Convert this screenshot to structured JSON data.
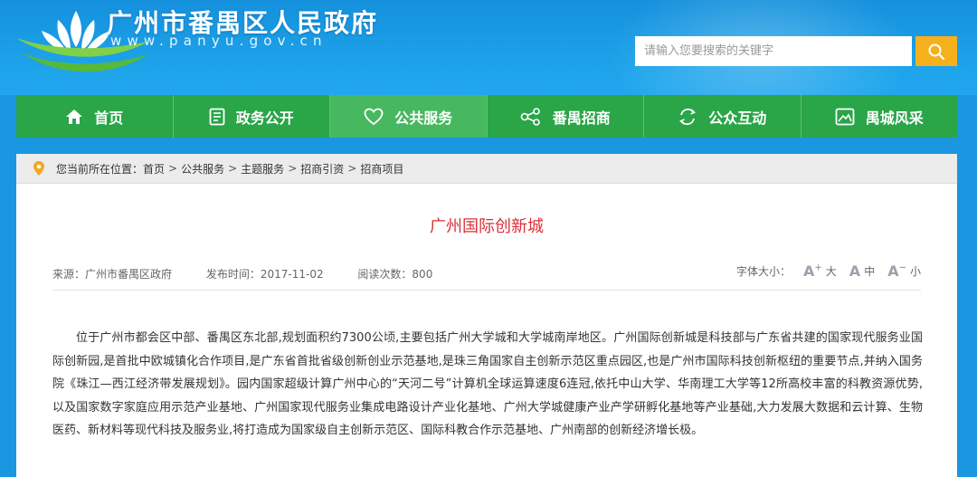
{
  "header": {
    "site_title": "广州市番禺区人民政府",
    "site_domain": "www.panyu.gov.cn",
    "search_placeholder": "请输入您要搜索的关键字",
    "logo_icon": "lotus-logo-icon",
    "search_icon": "search-icon"
  },
  "nav": {
    "items": [
      {
        "label": "首页",
        "icon": "home-icon"
      },
      {
        "label": "政务公开",
        "icon": "document-list-icon"
      },
      {
        "label": "公共服务",
        "icon": "heart-icon",
        "active": true
      },
      {
        "label": "番禺招商",
        "icon": "share-nodes-icon"
      },
      {
        "label": "公众互动",
        "icon": "refresh-icon"
      },
      {
        "label": "禺城风采",
        "icon": "image-icon"
      }
    ]
  },
  "breadcrumb": {
    "prefix": "您当前所在位置：",
    "items": [
      "首页",
      "公共服务",
      "主题服务",
      "招商引资",
      "招商项目"
    ],
    "separator": ">"
  },
  "article": {
    "title": "广州国际创新城",
    "source": "来源：广州市番禺区政府",
    "publish_time": "发布时间：2017-11-02",
    "views": "阅读次数：800",
    "fontsize_label": "字体大小：",
    "fontsize_large": "大",
    "fontsize_medium": "中",
    "fontsize_small": "小",
    "body": "位于广州市都会区中部、番禺区东北部,规划面积约7300公顷,主要包括广州大学城和大学城南岸地区。广州国际创新城是科技部与广东省共建的国家现代服务业国际创新园,是首批中欧城镇化合作项目,是广东省首批省级创新创业示范基地,是珠三角国家自主创新示范区重点园区,也是广州市国际科技创新枢纽的重要节点,并纳入国务院《珠江—西江经济带发展规划》。园内国家超级计算广州中心的“天河二号”计算机全球运算速度6连冠,依托中山大学、华南理工大学等12所高校丰富的科教资源优势,以及国家数字家庭应用示范产业基地、广州国家现代服务业集成电路设计产业化基地、广州大学城健康产业产学研孵化基地等产业基础,大力发展大数据和云计算、生物医药、新材料等现代科技及服务业,将打造成为国家级自主创新示范区、国际科教合作示范基地、广州南部的创新经济增长极。"
  },
  "colors": {
    "header_blue": "#1a97e0",
    "nav_green": "#2aa548",
    "nav_active": "#47b860",
    "search_button": "#f5b01b",
    "title_red": "#d8303a",
    "pin_orange": "#f5a623"
  }
}
